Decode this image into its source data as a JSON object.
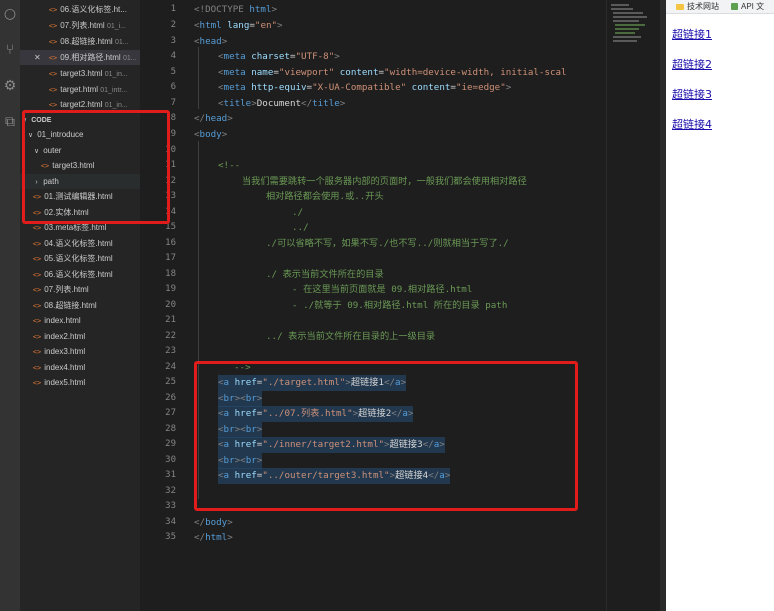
{
  "sidebar": {
    "open_editors": [
      {
        "label": "06.语义化标签.ht...",
        "desc": ""
      },
      {
        "label": "07.列表.html",
        "desc": "01_i..."
      },
      {
        "label": "08.超链接.html",
        "desc": "01..."
      },
      {
        "label": "09.相对路径.html",
        "desc": "01..."
      },
      {
        "label": "target3.html",
        "desc": "01_in..."
      },
      {
        "label": "target.html",
        "desc": "01_intr..."
      },
      {
        "label": "target2.html",
        "desc": "01_in..."
      }
    ],
    "section_title": "CODE",
    "tree": [
      {
        "label": "01_introduce",
        "type": "folder"
      },
      {
        "label": "outer",
        "type": "folder"
      },
      {
        "label": "target3.html",
        "type": "file"
      },
      {
        "label": "path",
        "type": "folder-collapsed"
      },
      {
        "label": "01.测试编辑器.html",
        "type": "file"
      },
      {
        "label": "02.实体.html",
        "type": "file"
      },
      {
        "label": "03.meta标签.html",
        "type": "file"
      },
      {
        "label": "04.语义化标签.html",
        "type": "file"
      },
      {
        "label": "05.语义化标签.html",
        "type": "file"
      },
      {
        "label": "06.语义化标签.html",
        "type": "file"
      },
      {
        "label": "07.列表.html",
        "type": "file"
      },
      {
        "label": "08.超链接.html",
        "type": "file"
      },
      {
        "label": "index.html",
        "type": "file"
      },
      {
        "label": "index2.html",
        "type": "file"
      },
      {
        "label": "index3.html",
        "type": "file"
      },
      {
        "label": "index4.html",
        "type": "file"
      },
      {
        "label": "index5.html",
        "type": "file"
      }
    ]
  },
  "editor": {
    "line_numbers": [
      "1",
      "2",
      "3",
      "4",
      "5",
      "6",
      "7",
      "8",
      "9",
      "10",
      "11",
      "12",
      "13",
      "14",
      "15",
      "16",
      "17",
      "18",
      "19",
      "20",
      "21",
      "22",
      "23",
      "24",
      "25",
      "26",
      "27",
      "28",
      "29",
      "30",
      "31",
      "32",
      "33",
      "34",
      "35"
    ],
    "lines": {
      "l1": [
        "<!DOCTYPE ",
        "html",
        ">"
      ],
      "l2": [
        "<",
        "html",
        " lang",
        "=",
        "\"en\"",
        ">"
      ],
      "l3": [
        "<",
        "head",
        ">"
      ],
      "l4": [
        "<",
        "meta",
        " charset",
        "=",
        "\"UTF-8\"",
        ">"
      ],
      "l5": [
        "<",
        "meta",
        " name",
        "=",
        "\"viewport\"",
        " content",
        "=",
        "\"width=device-width, initial-scal"
      ],
      "l6": [
        "<",
        "meta",
        " http-equiv",
        "=",
        "\"X-UA-Compatible\"",
        " content",
        "=",
        "\"ie=edge\"",
        ">"
      ],
      "l7": [
        "<",
        "title",
        ">",
        "Document",
        "</",
        "title",
        ">"
      ],
      "l8": [
        "</",
        "head",
        ">"
      ],
      "l9": [
        "<",
        "body",
        ">"
      ],
      "l11": "<!--",
      "l12": "当我们需要跳转一个服务器内部的页面时，一般我们都会使用相对路径",
      "l13": "相对路径都会使用.或..开头",
      "l14": "./",
      "l15": "../",
      "l16": "./可以省略不写，如果不写./也不写../则就相当于写了./",
      "l18": "./ 表示当前文件所在的目录",
      "l19": "- 在这里当前页面就是 09.相对路径.html",
      "l20": "- ./就等于 09.相对路径.html 所在的目录 path",
      "l22": "../ 表示当前文件所在目录的上一级目录",
      "l24": "-->",
      "l25": [
        "<",
        "a",
        " href",
        "=",
        "\"./target.html\"",
        ">",
        "超链接1",
        "</",
        "a",
        ">"
      ],
      "l26": [
        "<",
        "br",
        ">",
        "<",
        "br",
        ">"
      ],
      "l27": [
        "<",
        "a",
        " href",
        "=",
        "\"../07.列表.html\"",
        ">",
        "超链接2",
        "</",
        "a",
        ">"
      ],
      "l28": [
        "<",
        "br",
        ">",
        "<",
        "br",
        ">"
      ],
      "l29": [
        "<",
        "a",
        " href",
        "=",
        "\"./inner/target2.html\"",
        ">",
        "超链接3",
        "</",
        "a",
        ">"
      ],
      "l30": [
        "<",
        "br",
        ">",
        "<",
        "br",
        ">"
      ],
      "l31": [
        "<",
        "a",
        " href",
        "=",
        "\"../outer/target3.html\"",
        ">",
        "超链接4",
        "</",
        "a",
        ">"
      ],
      "l34": [
        "</",
        "body",
        ">"
      ],
      "l35": [
        "</",
        "html",
        ">"
      ]
    }
  },
  "browser": {
    "bookmarks": [
      "技术网站",
      "API 文"
    ],
    "links": [
      "超链接1",
      "超链接2",
      "超链接3",
      "超链接4"
    ]
  },
  "colors": {
    "tag": "#569cd6",
    "attr": "#9cdcfe",
    "string": "#ce9178",
    "comment": "#6a9955",
    "annotation": "#e21b1b",
    "link": "#1a0dab"
  }
}
